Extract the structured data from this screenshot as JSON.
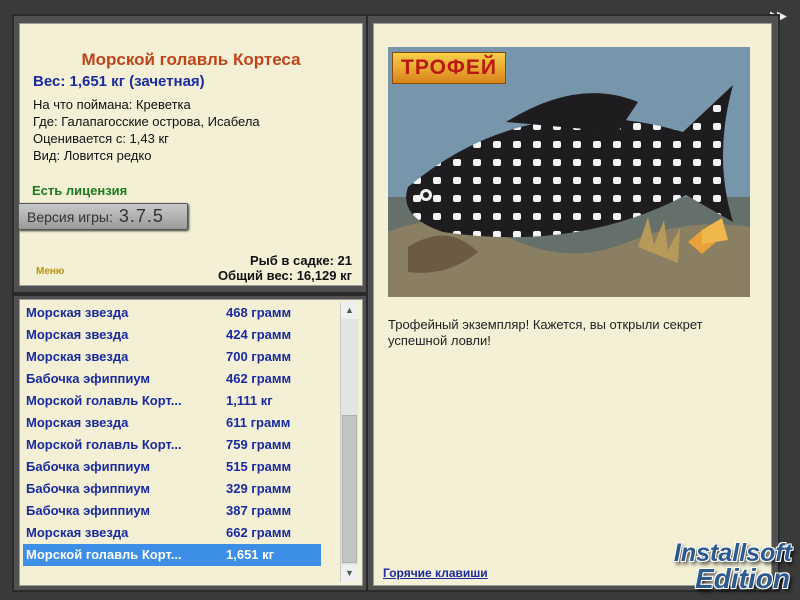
{
  "info": {
    "fish_name": "Морской голавль Кортеса",
    "weight": "Вес: 1,651 кг (зачетная)",
    "bait": "На что поймана: Креветка",
    "place": "Где: Галапагосские острова, Исабела",
    "rated_from": "Оценивается с: 1,43 кг",
    "kind": "Вид: Ловится редко",
    "license": "Есть лицензия",
    "version_label": "Версия игры:",
    "version_number": "3.7.5",
    "menu_label": "Меню",
    "keep_count": "Рыб в садке: 21",
    "total_weight": "Общий вес: 16,129 кг"
  },
  "catch_list": {
    "rows": [
      {
        "name": "Морская звезда",
        "weight": "468 грамм"
      },
      {
        "name": "Морская звезда",
        "weight": "424 грамм"
      },
      {
        "name": "Морская звезда",
        "weight": "700 грамм"
      },
      {
        "name": "Бабочка эфиппиум",
        "weight": "462 грамм"
      },
      {
        "name": "Морской голавль Корт...",
        "weight": "1,111 кг"
      },
      {
        "name": "Морская звезда",
        "weight": "611 грамм"
      },
      {
        "name": "Морской голавль Корт...",
        "weight": "759 грамм"
      },
      {
        "name": "Бабочка эфиппиум",
        "weight": "515 грамм"
      },
      {
        "name": "Бабочка эфиппиум",
        "weight": "329 грамм"
      },
      {
        "name": "Бабочка эфиппиум",
        "weight": "387 грамм"
      },
      {
        "name": "Морская звезда",
        "weight": "662 грамм"
      },
      {
        "name": "Морской голавль Корт...",
        "weight": "1,651 кг"
      }
    ],
    "selected_index": 11
  },
  "detail": {
    "trophy_badge": "ТРОФЕЙ",
    "description": "Трофейный экземпляр! Кажется, вы открыли секрет успешной ловли!",
    "hotkeys_link": "Горячие клавиши",
    "next_icon": "fast-forward-icon"
  },
  "logo": {
    "line1": "Installsoft",
    "line2": "Edition"
  },
  "colors": {
    "panel_bg": "#f3f0d6",
    "title": "#c0441a",
    "link": "#1a2aa0",
    "license": "#1d7a1d",
    "selection": "#3d8ee6"
  }
}
